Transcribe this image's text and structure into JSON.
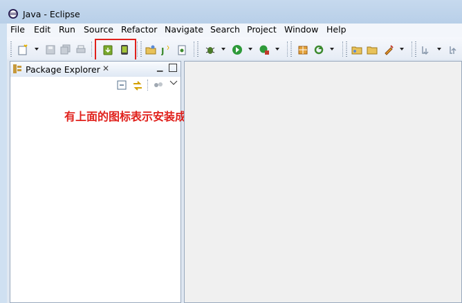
{
  "window": {
    "title": "Java - Eclipse",
    "icon": "eclipse-icon"
  },
  "menu": [
    "File",
    "Edit",
    "Run",
    "Source",
    "Refactor",
    "Navigate",
    "Search",
    "Project",
    "Window",
    "Help"
  ],
  "toolbar": {
    "icons": [
      "new-icon",
      "save-icon",
      "save-all-icon",
      "print-icon",
      "android-sdk-manager-icon",
      "android-avd-manager-icon",
      "open-type-icon",
      "new-java-class-icon",
      "new-file-icon",
      "debug-icon",
      "run-icon",
      "external-tools-icon",
      "open-perspective-icon",
      "refresh-icon",
      "open-folder-icon",
      "open-project-icon",
      "build-icon",
      "next-annotation-icon",
      "prev-annotation-icon"
    ]
  },
  "panel": {
    "title": "Package Explorer",
    "close_symbol": "✕",
    "minimize_symbol": "▁",
    "tools": [
      "collapse-all-icon",
      "link-with-editor-icon",
      "view-menu-icon"
    ]
  },
  "annotation": {
    "text": "有上面的图标表示安装成功",
    "color": "#e0201b"
  },
  "colors": {
    "highlight": "#e0201b",
    "chrome": "#cfe0f1"
  }
}
